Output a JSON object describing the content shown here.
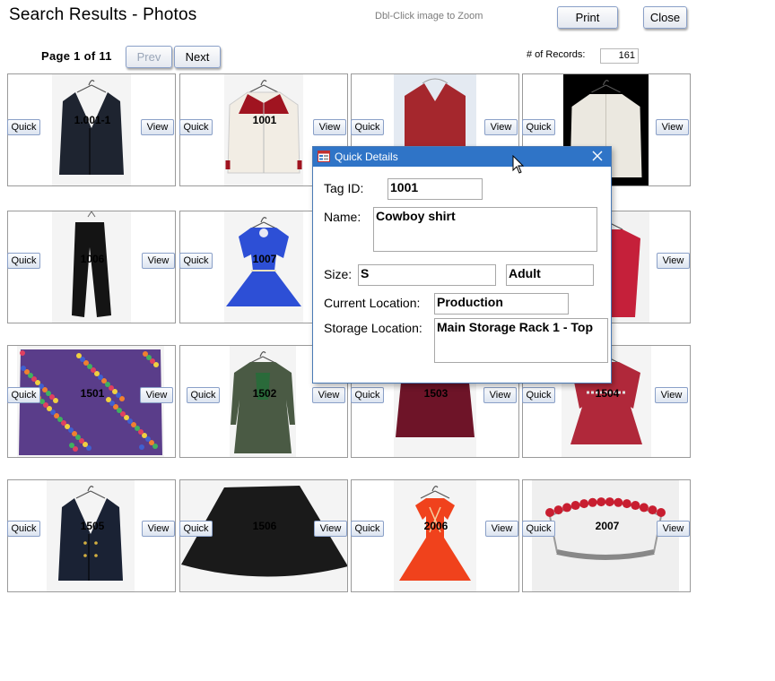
{
  "header": {
    "title": "Search Results - Photos",
    "hint": "Dbl-Click image to Zoom",
    "print_label": "Print",
    "close_label": "Close"
  },
  "pagination": {
    "page_text": "Page 1 of 11",
    "prev_label": "Prev",
    "next_label": "Next",
    "prev_enabled": false
  },
  "records": {
    "label": "# of Records:",
    "value": "161"
  },
  "card_buttons": {
    "quick": "Quick",
    "view": "View"
  },
  "grid": [
    {
      "tag": "1.001-1",
      "item": "suit-jacket",
      "color": "#1e2430"
    },
    {
      "tag": "1001",
      "item": "cowboy-shirt",
      "color": "#f2ede4"
    },
    {
      "tag": "",
      "item": "vest",
      "color": "#a5272d"
    },
    {
      "tag": "",
      "item": "white-jacket",
      "color": "#ebe8e0"
    },
    {
      "tag": "1006",
      "item": "pants",
      "color": "#141414"
    },
    {
      "tag": "1007",
      "item": "blue-dress",
      "color": "#2d4fd6"
    },
    {
      "tag": "",
      "item": "hidden",
      "color": "#ffffff"
    },
    {
      "tag": "",
      "item": "red-jacket",
      "color": "#c5203a"
    },
    {
      "tag": "1501",
      "item": "floral-skirt",
      "color": "#5a3d8a"
    },
    {
      "tag": "1502",
      "item": "green-dress",
      "color": "#4a5a44"
    },
    {
      "tag": "1503",
      "item": "maroon-skirt",
      "color": "#6e1428"
    },
    {
      "tag": "1504",
      "item": "red-dress",
      "color": "#b0283a"
    },
    {
      "tag": "1505",
      "item": "navy-blazer",
      "color": "#1a2234"
    },
    {
      "tag": "1506",
      "item": "black-skirt",
      "color": "#1a1a1a"
    },
    {
      "tag": "2006",
      "item": "orange-tutu",
      "color": "#f0421c"
    },
    {
      "tag": "2007",
      "item": "tiara",
      "color": "#c81e30"
    }
  ],
  "dialog": {
    "title": "Quick Details",
    "tag_label": "Tag ID:",
    "tag_value": "1001",
    "name_label": "Name:",
    "name_value": "Cowboy shirt",
    "size_label": "Size:",
    "size_value": "S",
    "age_value": "Adult",
    "current_location_label": "Current Location:",
    "current_location_value": "Production",
    "storage_location_label": "Storage Location:",
    "storage_location_value": "Main Storage Rack 1 - Top"
  }
}
